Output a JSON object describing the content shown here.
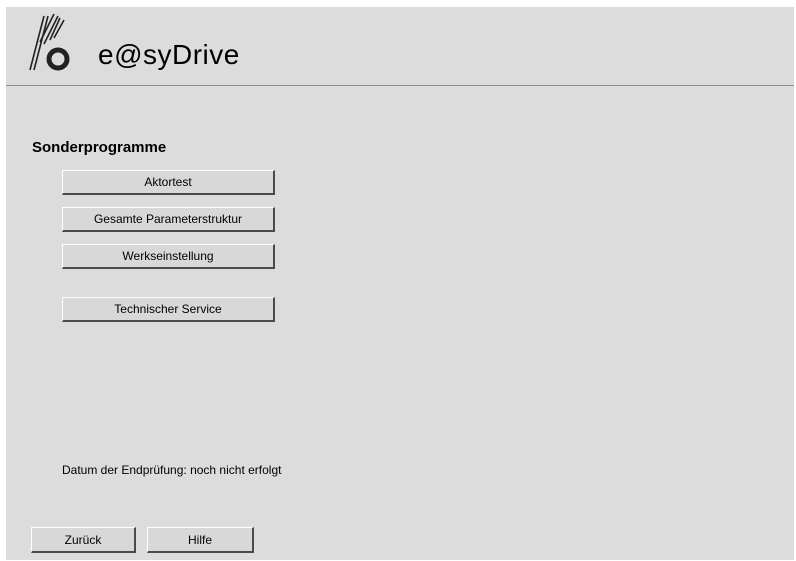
{
  "app": {
    "title": "e@syDrive",
    "logo_icon": "company-logo-icon"
  },
  "section": {
    "title": "Sonderprogramme"
  },
  "menu": {
    "aktortest": "Aktortest",
    "parameterstruktur": "Gesamte Parameterstruktur",
    "werkseinstellung": "Werkseinstellung",
    "technischer_service": "Technischer Service"
  },
  "info": {
    "endpruefung": "Datum der Endprüfung: noch nicht erfolgt"
  },
  "footer": {
    "back_label": "Zurück",
    "help_label": "Hilfe"
  }
}
